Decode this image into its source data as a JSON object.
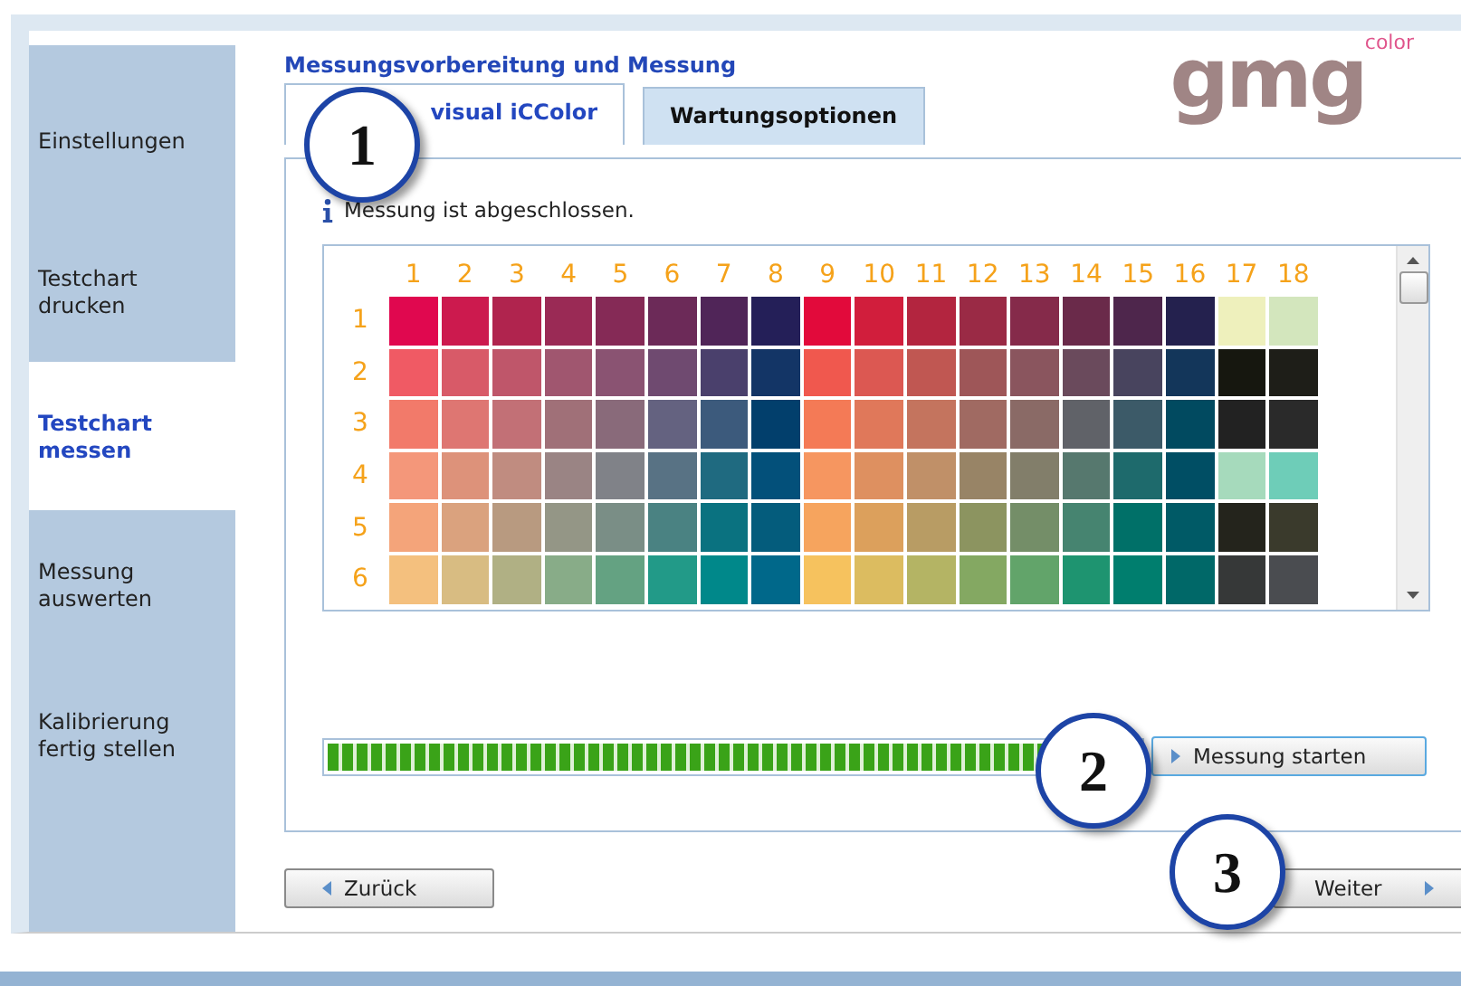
{
  "sidebar": {
    "items": [
      {
        "label": "Einstellungen",
        "selected": false
      },
      {
        "label": "Testchart drucken",
        "selected": false
      },
      {
        "label": "Testchart messen",
        "selected": true
      },
      {
        "label": "Messung auswerten",
        "selected": false
      },
      {
        "label": "Kalibrierung fertig stellen",
        "selected": false
      }
    ]
  },
  "title": "Messungsvorbereitung und Messung",
  "logo": {
    "text": "gmg",
    "superscript": "color"
  },
  "tabs": [
    {
      "label": "visual iCColor",
      "selected": true
    },
    {
      "label": "Wartungsoptionen",
      "selected": false
    }
  ],
  "info": "Messung ist abgeschlossen.",
  "chart": {
    "column_labels": [
      "1",
      "2",
      "3",
      "4",
      "5",
      "6",
      "7",
      "8",
      "9",
      "10",
      "11",
      "12",
      "13",
      "14",
      "15",
      "16",
      "17",
      "18"
    ],
    "rows": [
      {
        "label": "1",
        "swatches": [
          {
            "color": "#e0084f"
          },
          {
            "color": "#cc1a4e"
          },
          {
            "color": "#b0244e"
          },
          {
            "color": "#9a2a55"
          },
          {
            "color": "#852a56"
          },
          {
            "color": "#6c2a58"
          },
          {
            "color": "#502558"
          },
          {
            "color": "#241f58"
          },
          {
            "color": "#e20a3b"
          },
          {
            "color": "#d11e3c"
          },
          {
            "color": "#b3253f"
          },
          {
            "color": "#9a2a45"
          },
          {
            "color": "#852a4a"
          },
          {
            "color": "#6a2a4a"
          },
          {
            "color": "#4e264c"
          },
          {
            "color": "#24214e"
          },
          {
            "color": "#eef0bc"
          },
          {
            "color": "#d3e6bd"
          }
        ]
      },
      {
        "label": "2",
        "swatches": [
          {
            "color": "#f05a64"
          },
          {
            "color": "#d85a68"
          },
          {
            "color": "#bf566a"
          },
          {
            "color": "#a0566f"
          },
          {
            "color": "#8a5372"
          },
          {
            "color": "#6f4a70"
          },
          {
            "color": "#4a406c"
          },
          {
            "color": "#133566"
          },
          {
            "color": "#f0584e"
          },
          {
            "color": "#dc5852"
          },
          {
            "color": "#c05752"
          },
          {
            "color": "#9e5658"
          },
          {
            "color": "#8a555e"
          },
          {
            "color": "#6a4a5c"
          },
          {
            "color": "#48445e"
          },
          {
            "color": "#13365a"
          },
          {
            "color": "#16170f"
          },
          {
            "color": "#1e1e18"
          }
        ]
      },
      {
        "label": "3",
        "swatches": [
          {
            "color": "#f27a6a"
          },
          {
            "color": "#de7672"
          },
          {
            "color": "#c27076"
          },
          {
            "color": "#a07078"
          },
          {
            "color": "#896a7a"
          },
          {
            "color": "#646280"
          },
          {
            "color": "#3c5a7c"
          },
          {
            "color": "#023f6c"
          },
          {
            "color": "#f47a56"
          },
          {
            "color": "#e0785a"
          },
          {
            "color": "#c4745e"
          },
          {
            "color": "#a06a62"
          },
          {
            "color": "#8a6a66"
          },
          {
            "color": "#606268"
          },
          {
            "color": "#3c5a68"
          },
          {
            "color": "#014a60"
          },
          {
            "color": "#222222"
          },
          {
            "color": "#2a2a2a"
          }
        ]
      },
      {
        "label": "4",
        "swatches": [
          {
            "color": "#f4977a"
          },
          {
            "color": "#dd927a"
          },
          {
            "color": "#c08c80"
          },
          {
            "color": "#9a8484"
          },
          {
            "color": "#808288"
          },
          {
            "color": "#587284"
          },
          {
            "color": "#1f6a80"
          },
          {
            "color": "#03507a"
          },
          {
            "color": "#f69660"
          },
          {
            "color": "#de9060"
          },
          {
            "color": "#c09068"
          },
          {
            "color": "#988466"
          },
          {
            "color": "#827e6a"
          },
          {
            "color": "#56786e"
          },
          {
            "color": "#1e6a6c"
          },
          {
            "color": "#004e64"
          },
          {
            "color": "#a6dabc"
          },
          {
            "color": "#6ecdb8"
          }
        ]
      },
      {
        "label": "5",
        "swatches": [
          {
            "color": "#f4a47a"
          },
          {
            "color": "#daa27e"
          },
          {
            "color": "#b89a80"
          },
          {
            "color": "#949686"
          },
          {
            "color": "#7a8e86"
          },
          {
            "color": "#4a8282"
          },
          {
            "color": "#0a7280"
          },
          {
            "color": "#045c7c"
          },
          {
            "color": "#f6a45e"
          },
          {
            "color": "#dca05c"
          },
          {
            "color": "#b89c64"
          },
          {
            "color": "#8c9460"
          },
          {
            "color": "#748e68"
          },
          {
            "color": "#468470"
          },
          {
            "color": "#007068"
          },
          {
            "color": "#005a66"
          },
          {
            "color": "#24241c"
          },
          {
            "color": "#3a3a2c"
          }
        ]
      },
      {
        "label": "6",
        "swatches": [
          {
            "color": "#f4c07e"
          },
          {
            "color": "#d8bc82"
          },
          {
            "color": "#b0b084"
          },
          {
            "color": "#88ac88"
          },
          {
            "color": "#64a282"
          },
          {
            "color": "#229a88"
          },
          {
            "color": "#00888a"
          },
          {
            "color": "#00688a"
          },
          {
            "color": "#f6c25e"
          },
          {
            "color": "#dcbc60"
          },
          {
            "color": "#b4b464"
          },
          {
            "color": "#84a862"
          },
          {
            "color": "#62a46a"
          },
          {
            "color": "#1e9470"
          },
          {
            "color": "#007e6e"
          },
          {
            "color": "#006868"
          },
          {
            "color": "#363838"
          },
          {
            "color": "#4a4c50"
          }
        ]
      }
    ]
  },
  "progress": {
    "level": 1
  },
  "buttons": {
    "start": "Messung starten",
    "back": "Zurück",
    "next": "Weiter"
  },
  "callouts": [
    "1",
    "2",
    "3"
  ]
}
